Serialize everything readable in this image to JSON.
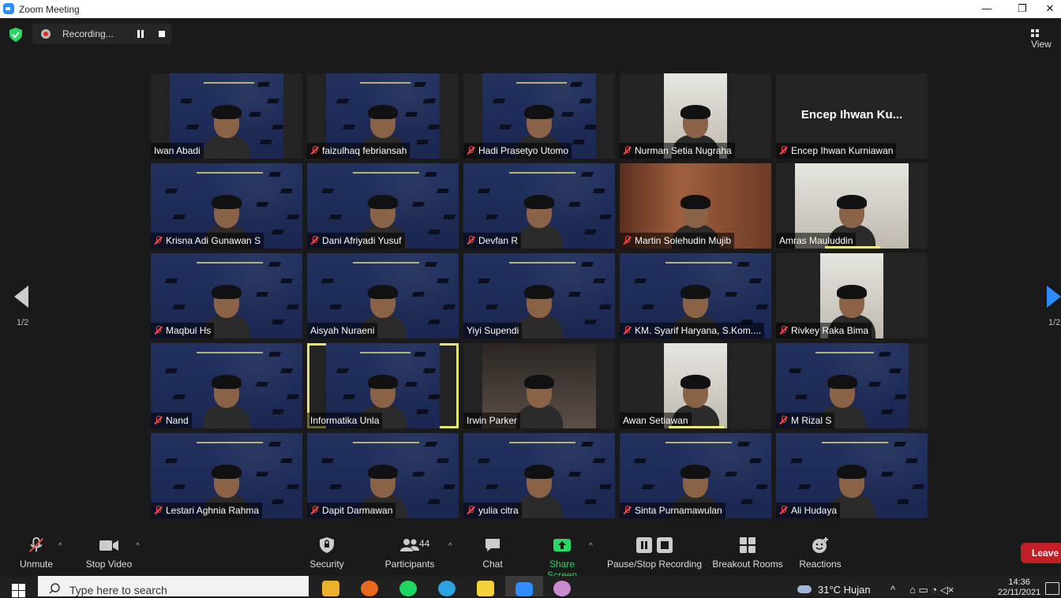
{
  "window": {
    "title": "Zoom Meeting",
    "minimize": "—",
    "restore": "❐",
    "close": "✕"
  },
  "topbar": {
    "recording_label": "Recording...",
    "view_label": "View"
  },
  "nav": {
    "page": "1/2",
    "page_right": "1/2"
  },
  "tiles": [
    {
      "name": "Iwan Abadi",
      "muted": false
    },
    {
      "name": "faizulhaq febriansah",
      "muted": true
    },
    {
      "name": "Hadi Prasetyo Utomo",
      "muted": true
    },
    {
      "name": "Nurman Setia Nugraha",
      "muted": true
    },
    {
      "name": "Encep Ihwan Kurniawan",
      "muted": true,
      "video_off_label": "Encep Ihwan Ku..."
    },
    {
      "name": "Krisna Adi Gunawan S",
      "muted": true
    },
    {
      "name": "Dani Afriyadi Yusuf",
      "muted": true
    },
    {
      "name": "Devfan R",
      "muted": true
    },
    {
      "name": "Martin Solehudin Mujib",
      "muted": true
    },
    {
      "name": "Amras Mauluddin",
      "muted": false
    },
    {
      "name": "Maqbul Hs",
      "muted": true
    },
    {
      "name": "Aisyah Nuraeni",
      "muted": false
    },
    {
      "name": "Yiyi Supendi",
      "muted": false
    },
    {
      "name": "KM. Syarif Haryana, S.Kom....",
      "muted": true
    },
    {
      "name": "Rivkey Raka Bima",
      "muted": true
    },
    {
      "name": "Nand",
      "muted": true
    },
    {
      "name": "Informatika Unla",
      "muted": false
    },
    {
      "name": "Irwin Parker",
      "muted": false
    },
    {
      "name": "Awan Setiawan",
      "muted": false
    },
    {
      "name": "M Rizal S",
      "muted": true
    },
    {
      "name": "Lestari Aghnia Rahma",
      "muted": true
    },
    {
      "name": "Dapit Darmawan",
      "muted": true
    },
    {
      "name": "yulia citra",
      "muted": true
    },
    {
      "name": "Sinta Purnamawulan",
      "muted": true
    },
    {
      "name": "Ali Hudaya",
      "muted": true
    }
  ],
  "toolbar": {
    "unmute": "Unmute",
    "stop_video": "Stop Video",
    "security": "Security",
    "participants": "Participants",
    "participants_count": "44",
    "chat": "Chat",
    "share_screen": "Share Screen",
    "recording": "Pause/Stop Recording",
    "breakout": "Breakout Rooms",
    "reactions": "Reactions",
    "leave": "Leave"
  },
  "taskbar": {
    "search_placeholder": "Type here to search",
    "weather": "31°C  Hujan",
    "time": "14:36",
    "date": "22/11/2021"
  },
  "colors": {
    "accent_green": "#2bd663",
    "leave_red": "#c21e25",
    "active_speaker": "#e6e66a",
    "mute_red": "#ff4b4b"
  }
}
